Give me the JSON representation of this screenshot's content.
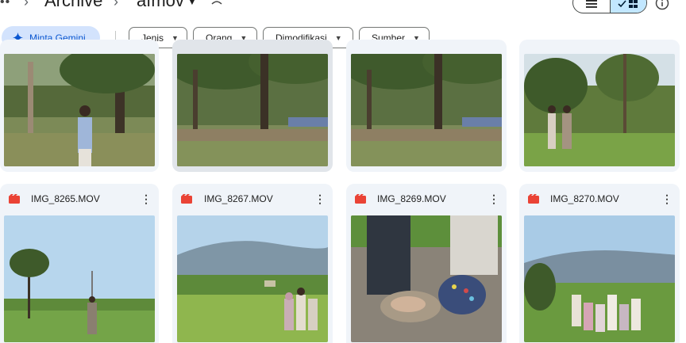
{
  "breadcrumb": {
    "overflow": "••",
    "items": [
      "Archive",
      "afmov"
    ]
  },
  "view_toggle": {
    "list_icon": "list-icon",
    "grid_icon": "grid-icon",
    "selected": "grid"
  },
  "filters": {
    "gemini_label": "Minta Gemini",
    "chips": [
      "Jenis",
      "Orang",
      "Dimodifikasi",
      "Sumber"
    ]
  },
  "files_top": [
    {
      "name": ""
    },
    {
      "name": ""
    },
    {
      "name": ""
    },
    {
      "name": ""
    }
  ],
  "files": [
    {
      "name": "IMG_8265.MOV"
    },
    {
      "name": "IMG_8267.MOV"
    },
    {
      "name": "IMG_8269.MOV"
    },
    {
      "name": "IMG_8270.MOV"
    }
  ],
  "colors": {
    "accent": "#0b57d0",
    "selected_bg": "#c2e7ff",
    "video_icon": "#ea4335"
  }
}
